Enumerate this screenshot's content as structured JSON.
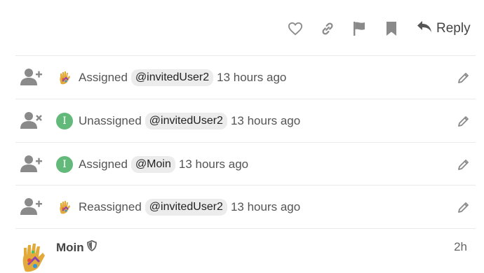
{
  "actions": {
    "like_icon": "heart-icon",
    "link_icon": "link-icon",
    "flag_icon": "flag-icon",
    "bookmark_icon": "bookmark-icon",
    "reply_label": "Reply"
  },
  "events": [
    {
      "icon": "user-plus-icon",
      "avatar": "handprint",
      "action": "Assigned",
      "mention": "@invitedUser2",
      "time": "13 hours ago"
    },
    {
      "icon": "user-times-icon",
      "avatar": "I",
      "action": "Unassigned",
      "mention": "@invitedUser2",
      "time": "13 hours ago"
    },
    {
      "icon": "user-plus-icon",
      "avatar": "I",
      "action": "Assigned",
      "mention": "@Moin",
      "time": "13 hours ago"
    },
    {
      "icon": "user-plus-icon",
      "avatar": "handprint",
      "action": "Reassigned",
      "mention": "@invitedUser2",
      "time": "13 hours ago"
    }
  ],
  "post": {
    "username": "Moin",
    "badge_icon": "shield-icon",
    "time": "2h"
  },
  "colors": {
    "icon_gray": "#8a8a8a",
    "avatar_green": "#62b97a",
    "mention_bg": "#ececec"
  }
}
